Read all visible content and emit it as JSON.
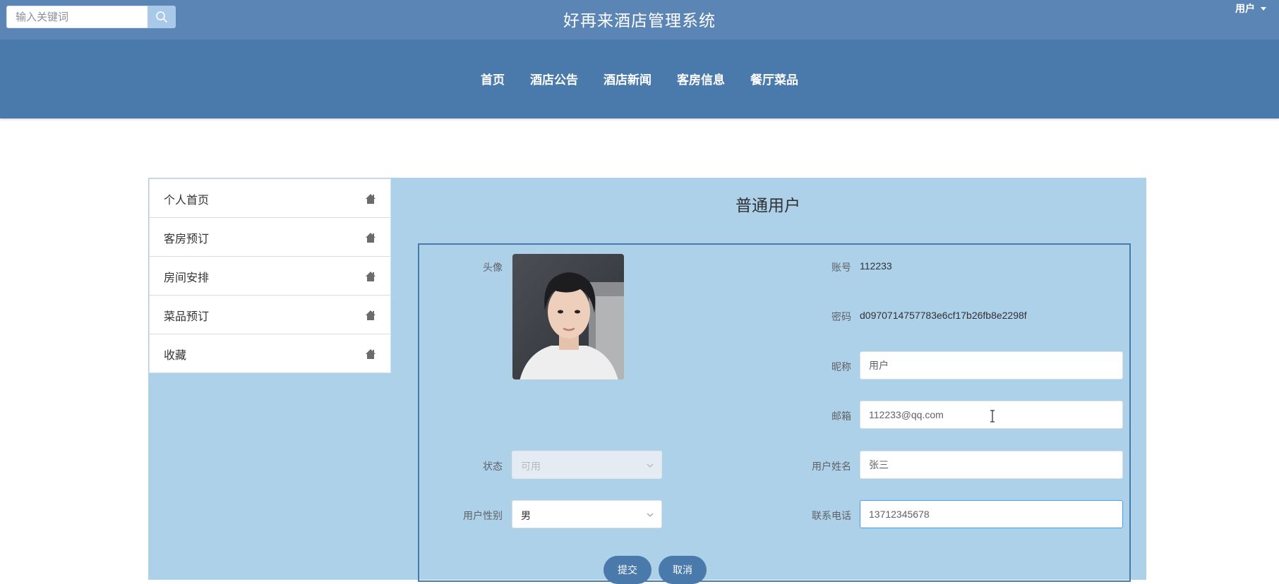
{
  "header": {
    "search_placeholder": "输入关键词",
    "site_title": "好再来酒店管理系统",
    "user_menu_label": "用户"
  },
  "nav": {
    "items": [
      "首页",
      "酒店公告",
      "酒店新闻",
      "客房信息",
      "餐厅菜品"
    ]
  },
  "sidebar": {
    "items": [
      {
        "label": "个人首页",
        "icon": "home-icon"
      },
      {
        "label": "客房预订",
        "icon": "home-icon"
      },
      {
        "label": "房间安排",
        "icon": "home-icon"
      },
      {
        "label": "菜品预订",
        "icon": "home-icon"
      },
      {
        "label": "收藏",
        "icon": "home-icon"
      }
    ]
  },
  "profile": {
    "heading": "普通用户",
    "avatar_label": "头像",
    "account_label": "账号",
    "account_value": "112233",
    "password_label": "密码",
    "password_value": "d0970714757783e6cf17b26fb8e2298f",
    "nickname_label": "昵称",
    "nickname_value": "用户",
    "email_label": "邮箱",
    "email_value": "112233@qq.com",
    "status_label": "状态",
    "status_value": "可用",
    "realname_label": "用户姓名",
    "realname_value": "张三",
    "gender_label": "用户性别",
    "gender_value": "男",
    "phone_label": "联系电话",
    "phone_value": "13712345678",
    "submit_label": "提交",
    "cancel_label": "取消"
  },
  "colors": {
    "topbar": "#5b85b5",
    "navbar": "#4a79ab",
    "panel": "#aed1ea",
    "button": "#4a79ab"
  }
}
